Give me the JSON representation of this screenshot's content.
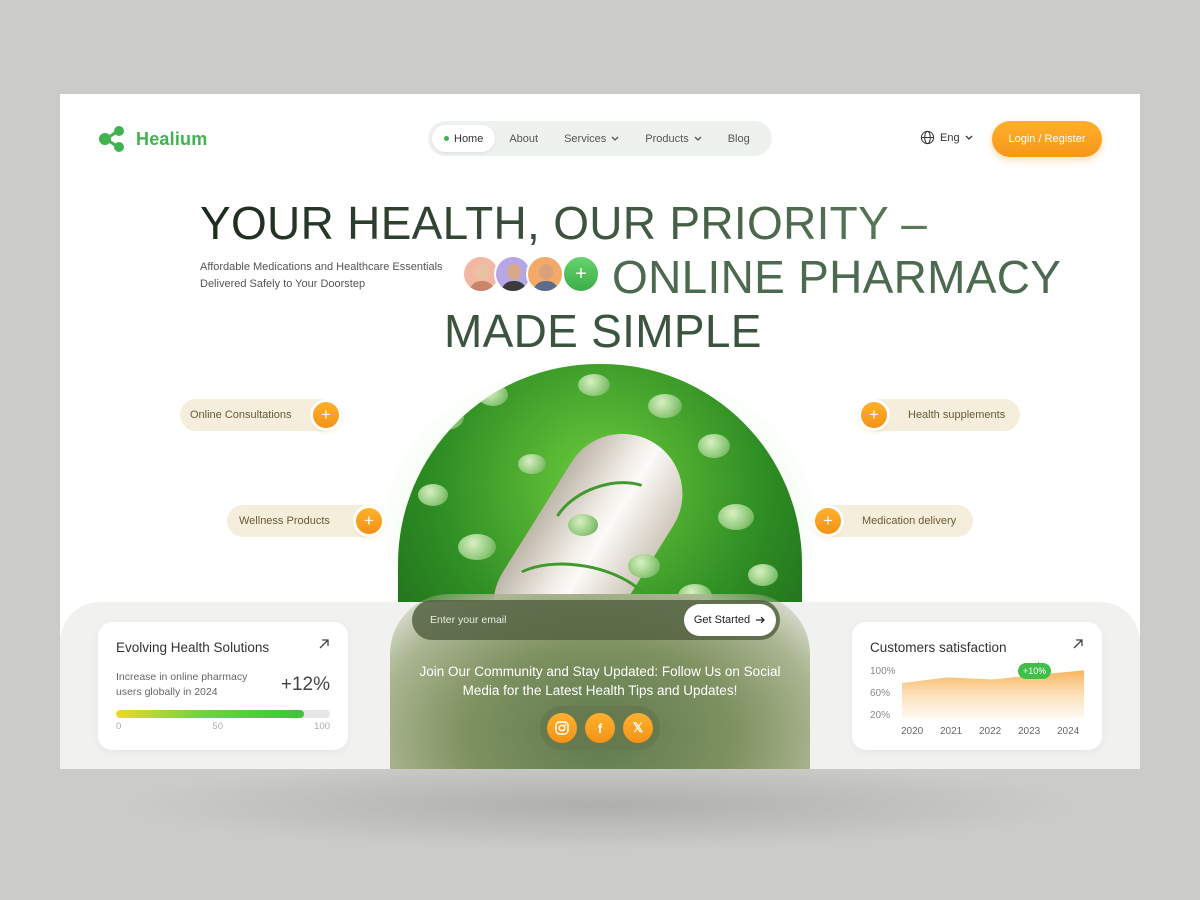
{
  "brand": {
    "name": "Healium",
    "color": "#3fb34f"
  },
  "nav": {
    "items": [
      {
        "label": "Home",
        "active": true
      },
      {
        "label": "About"
      },
      {
        "label": "Services",
        "dropdown": true
      },
      {
        "label": "Products",
        "dropdown": true
      },
      {
        "label": "Blog"
      }
    ]
  },
  "header": {
    "lang": "Eng",
    "login": "Login / Register",
    "accent": "#f6a01f"
  },
  "hero": {
    "line1": "YOUR HEALTH, OUR PRIORITY –",
    "line2": "ONLINE PHARMACY",
    "line3": "MADE SIMPLE",
    "subtitle": "Affordable Medications and Healthcare Essentials Delivered Safely to Your Doorstep",
    "plus": "+"
  },
  "features": {
    "online_consultations": "Online Consultations",
    "wellness_products": "Wellness Products",
    "health_supplements": "Health supplements",
    "medication_delivery": "Medication delivery"
  },
  "signup": {
    "placeholder": "Enter your email",
    "button": "Get Started",
    "join_text": "Join Our Community and Stay Updated: Follow Us on Social Media for the Latest Health Tips and Updates!"
  },
  "social": {
    "icons": [
      "instagram-icon",
      "facebook-icon",
      "x-icon"
    ],
    "facebook_glyph": "f",
    "x_glyph": "𝕏"
  },
  "card_left": {
    "title": "Evolving Health Solutions",
    "desc": "Increase in online pharmacy users globally in 2024",
    "value": "+12%",
    "progress": 0.88,
    "ticks": [
      "0",
      "50",
      "100"
    ]
  },
  "card_right": {
    "title": "Customers satisfaction",
    "badge": "+10%",
    "y_ticks": [
      "100%",
      "60%",
      "20%"
    ],
    "x_ticks": [
      "2020",
      "2021",
      "2022",
      "2023",
      "2024"
    ]
  },
  "chart_data": {
    "type": "area",
    "title": "Customers satisfaction",
    "x": [
      "2020",
      "2021",
      "2022",
      "2023",
      "2024"
    ],
    "values": [
      70,
      78,
      75,
      82,
      88
    ],
    "ylim": [
      20,
      100
    ],
    "annotations": [
      {
        "x": "2023",
        "label": "+10%"
      }
    ],
    "grid": false
  }
}
